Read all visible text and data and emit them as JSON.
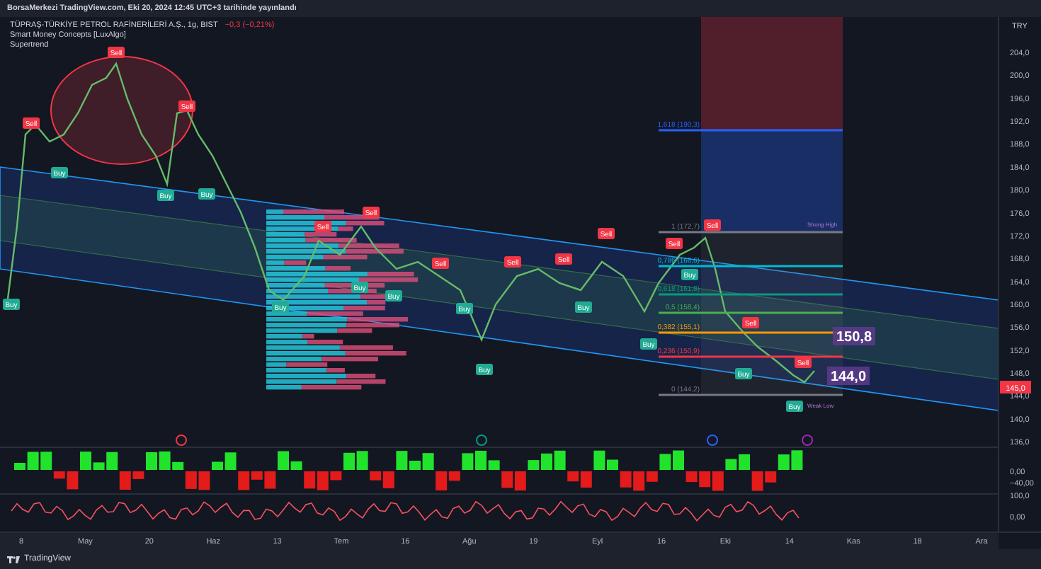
{
  "attribution": "BorsaMerkezi TradingView.com, Eki 20, 2024 12:45 UTC+3 tarihinde yayınlandı",
  "legend": {
    "symbol": "TÜPRAŞ-TÜRKİYE PETROL RAFİNERİLERİ A.Ş., 1g, BIST",
    "change": "−0,3 (−0,21%)",
    "indicators": [
      "Smart Money Concepts [LuxAlgo]",
      "Supertrend"
    ]
  },
  "currency": "TRY",
  "price_axis": [
    "204,0",
    "200,0",
    "196,0",
    "192,0",
    "188,0",
    "184,0",
    "180,0",
    "176,0",
    "172,0",
    "168,0",
    "164,0",
    "160,0",
    "156,0",
    "152,0",
    "148,0",
    "144,0",
    "140,0",
    "136,0"
  ],
  "last_price": "145,0",
  "indicator_axis": [
    "0,00",
    "−40,00",
    "100,0",
    "0,00"
  ],
  "time_axis": [
    "8",
    "May",
    "20",
    "Haz",
    "13",
    "Tem",
    "16",
    "Ağu",
    "19",
    "Eyl",
    "16",
    "Eki",
    "14",
    "Kas",
    "18",
    "Ara"
  ],
  "fib_levels": [
    {
      "label": "1,618 (190,3)",
      "color": "#2962ff"
    },
    {
      "label": "1 (172,7)",
      "color": "#787b86"
    },
    {
      "label": "0,786 (166,6)",
      "color": "#00bcd4"
    },
    {
      "label": "0,618 (161,8)",
      "color": "#089981"
    },
    {
      "label": "0,5 (158,4)",
      "color": "#4caf50"
    },
    {
      "label": "0,382 (155,1)",
      "color": "#ff9800"
    },
    {
      "label": "0,236 (150,9)",
      "color": "#f23645"
    },
    {
      "label": "0 (144,2)",
      "color": "#787b86"
    }
  ],
  "price_tags": [
    "150,8",
    "144,0"
  ],
  "smc_labels": [
    "Strong High",
    "Weak Low"
  ],
  "signals": [
    {
      "kind": "sell",
      "label": "Sell"
    },
    {
      "kind": "sell",
      "label": "Sell"
    },
    {
      "kind": "buy",
      "label": "Buy"
    },
    {
      "kind": "sell",
      "label": "Sell"
    },
    {
      "kind": "buy",
      "label": "Buy"
    },
    {
      "kind": "buy",
      "label": "Buy"
    },
    {
      "kind": "sell",
      "label": "Sell"
    },
    {
      "kind": "sell",
      "label": "Sell"
    },
    {
      "kind": "buy",
      "label": "Buy"
    },
    {
      "kind": "buy",
      "label": "Buy"
    },
    {
      "kind": "sell",
      "label": "Sell"
    },
    {
      "kind": "sell",
      "label": "Sell"
    },
    {
      "kind": "sell",
      "label": "Sell"
    },
    {
      "kind": "sell",
      "label": "Sell"
    },
    {
      "kind": "buy",
      "label": "Buy"
    },
    {
      "kind": "buy",
      "label": "Buy"
    },
    {
      "kind": "buy",
      "label": "Buy"
    },
    {
      "kind": "buy",
      "label": "Buy"
    },
    {
      "kind": "buy",
      "label": "Buy"
    },
    {
      "kind": "sell",
      "label": "Sell"
    },
    {
      "kind": "sell",
      "label": "Sell"
    },
    {
      "kind": "buy",
      "label": "Buy"
    },
    {
      "kind": "sell",
      "label": "Sell"
    },
    {
      "kind": "buy",
      "label": "Buy"
    },
    {
      "kind": "sell",
      "label": "Sell"
    },
    {
      "kind": "buy",
      "label": "Buy"
    },
    {
      "kind": "buy",
      "label": "Buy"
    }
  ],
  "events": [
    {
      "color": "#f23645"
    },
    {
      "color": "#089981"
    },
    {
      "color": "#2962ff"
    },
    {
      "color": "#9c27b0"
    }
  ],
  "footer": {
    "brand": "TradingView"
  }
}
